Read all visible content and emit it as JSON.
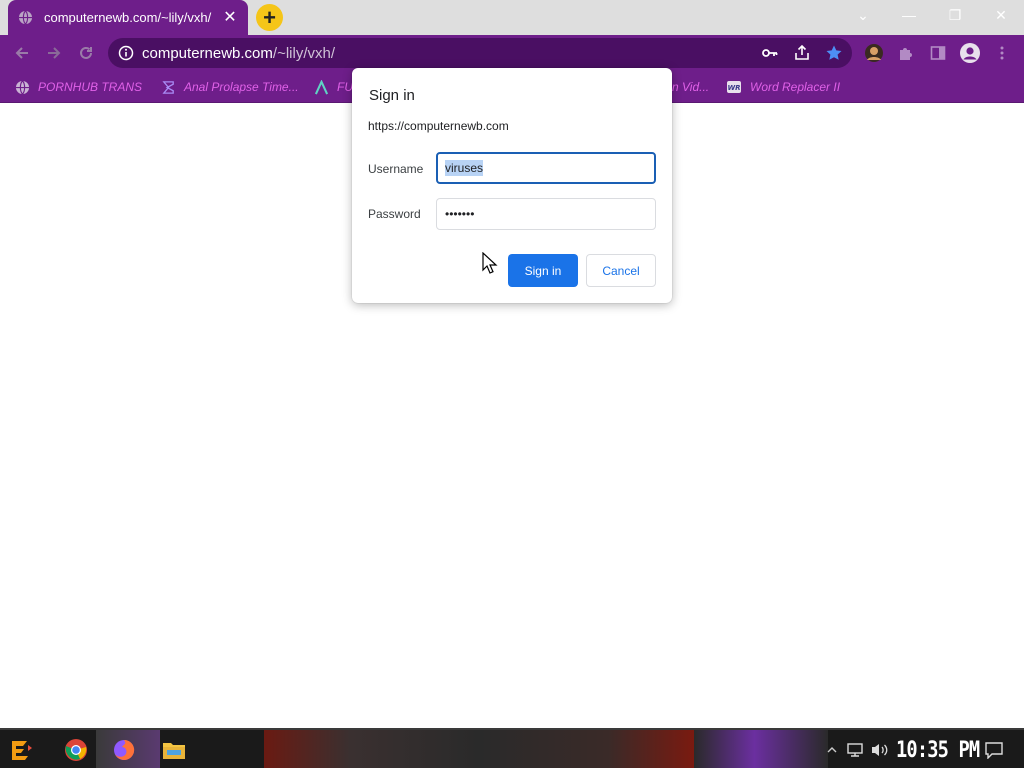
{
  "tab": {
    "title": "computernewb.com/~lily/vxh/",
    "close_glyph": "✕"
  },
  "newtab_glyph": "+",
  "window_controls": {
    "dropdown": "⌄",
    "minimize": "—",
    "restore": "❐",
    "close": "✕"
  },
  "address_bar": {
    "host": "computernewb.com",
    "path": "/~lily/vxh/"
  },
  "bookmarks": [
    {
      "label": "PORNHUB TRANS",
      "icon": "globe-icon"
    },
    {
      "label": "Anal Prolapse Time...",
      "icon": "sigma-icon"
    },
    {
      "label": "FU",
      "icon": "lambda-icon"
    },
    {
      "label": "n Vid...",
      "icon": ""
    },
    {
      "label": "Word Replacer II",
      "icon": "wr-icon"
    }
  ],
  "dialog": {
    "title": "Sign in",
    "origin": "https://computernewb.com",
    "username_label": "Username",
    "username_value": "viruses",
    "password_label": "Password",
    "password_value": "•••••••",
    "signin_label": "Sign in",
    "cancel_label": "Cancel"
  },
  "taskbar": {
    "clock": "10:35 PM"
  },
  "colors": {
    "accent": "#6e1e8a",
    "omnibox": "#4a0f63",
    "bookmark_text": "#e061e8",
    "primary_button": "#1a73e8",
    "newtab": "#f5c518"
  }
}
